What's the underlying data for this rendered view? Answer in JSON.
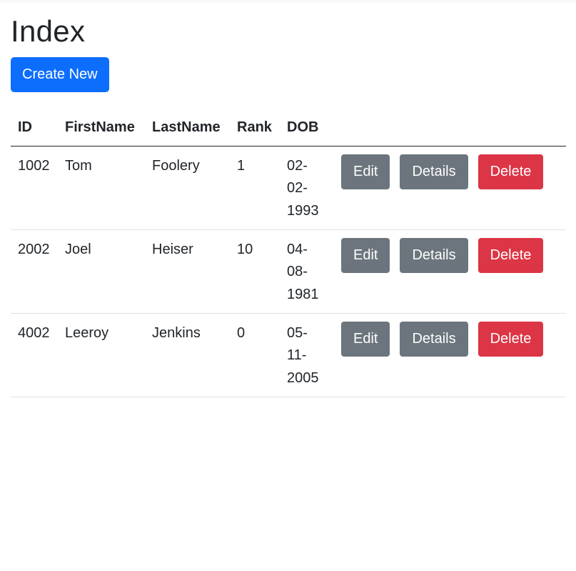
{
  "page": {
    "title": "Index",
    "create_label": "Create New"
  },
  "table": {
    "headers": [
      "ID",
      "FirstName",
      "LastName",
      "Rank",
      "DOB"
    ],
    "rows": [
      {
        "id": "1002",
        "first": "Tom",
        "last": "Foolery",
        "rank": "1",
        "dob": [
          "02-",
          "02-",
          "1993"
        ]
      },
      {
        "id": "2002",
        "first": "Joel",
        "last": "Heiser",
        "rank": "10",
        "dob": [
          "04-",
          "08-",
          "1981"
        ]
      },
      {
        "id": "4002",
        "first": "Leeroy",
        "last": "Jenkins",
        "rank": "0",
        "dob": [
          "05-",
          "11-",
          "2005"
        ]
      }
    ],
    "actions": {
      "edit_label": "Edit",
      "details_label": "Details",
      "delete_label": "Delete"
    }
  },
  "colors": {
    "primary": "#0d6efd",
    "secondary": "#6c757d",
    "danger": "#dc3545"
  }
}
